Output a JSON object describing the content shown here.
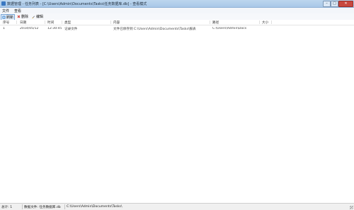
{
  "window": {
    "title": "数据管理 - 任务列表 - [C:\\Users\\Admin\\Documents\\Tasks\\任务数据库.db] - 查看模式",
    "minimize": "–",
    "maximize": "□",
    "close": "✕"
  },
  "menubar": {
    "items": [
      "文件",
      "查看"
    ]
  },
  "toolbar": {
    "refresh_label": "刷新",
    "delete_label": "删除",
    "edit_label": "编辑"
  },
  "table": {
    "headers": [
      "序号",
      "日期",
      "时间",
      "类型",
      "内容",
      "路径",
      "大小"
    ],
    "rows": [
      [
        "1",
        "2014/05/12",
        "12:30:45",
        "记录文件",
        "文件已保存到 C:\\Users\\Admin\\Documents\\Tasks\\报表",
        "C:\\Users\\Admin\\Docs",
        ""
      ]
    ]
  },
  "status": {
    "left": "总计: 1",
    "middle": "数据文件: 任务数据库.db",
    "right": "C:\\Users\\Admin\\Documents\\Tasks\\"
  },
  "colors": {
    "titlebar": "#a9c8e8",
    "close_button": "#c8483f",
    "statusbar": "#f0f0f0"
  }
}
